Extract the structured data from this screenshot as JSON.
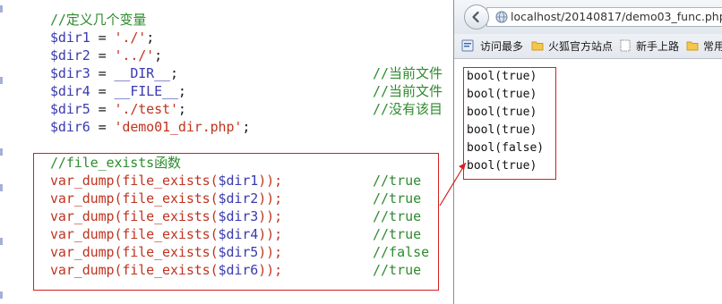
{
  "editor": {
    "lines": [
      {
        "id": "comment_define",
        "comment": "//定义几个变量"
      },
      {
        "var": "$dir1",
        "op": " = ",
        "value": "'./'",
        "end": ";"
      },
      {
        "var": "$dir2",
        "op": " = ",
        "value": "'../'",
        "end": ";"
      },
      {
        "var": "$dir3",
        "op": " = ",
        "const": "__DIR__",
        "end": ";",
        "trail": "//当前文件"
      },
      {
        "var": "$dir4",
        "op": " = ",
        "const": "__FILE__",
        "end": ";",
        "trail": "//当前文件"
      },
      {
        "var": "$dir5",
        "op": " = ",
        "value": "'./test'",
        "end": ";",
        "trail": "//没有该目"
      },
      {
        "var": "$dir6",
        "op": " = ",
        "value": "'demo01_dir.php'",
        "end": ";"
      }
    ],
    "block_comment": "//file_exists函数",
    "calls": [
      {
        "func": "var_dump(file_exists(",
        "arg": "$dir1",
        "close": "));",
        "result": "//true"
      },
      {
        "func": "var_dump(file_exists(",
        "arg": "$dir2",
        "close": "));",
        "result": "//true"
      },
      {
        "func": "var_dump(file_exists(",
        "arg": "$dir3",
        "close": "));",
        "result": "//true"
      },
      {
        "func": "var_dump(file_exists(",
        "arg": "$dir4",
        "close": "));",
        "result": "//true"
      },
      {
        "func": "var_dump(file_exists(",
        "arg": "$dir5",
        "close": "));",
        "result": "//false"
      },
      {
        "func": "var_dump(file_exists(",
        "arg": "$dir6",
        "close": "));",
        "result": "//true"
      }
    ]
  },
  "browser": {
    "url": "localhost/20140817/demo03_func.php",
    "bookmarks": [
      {
        "label": "访问最多",
        "icon": "bookmark-page-icon"
      },
      {
        "label": "火狐官方站点",
        "icon": "folder-icon"
      },
      {
        "label": "新手上路",
        "icon": "page-icon"
      },
      {
        "label": "常用",
        "icon": "folder-icon"
      }
    ],
    "output": [
      "bool(true)",
      "bool(true)",
      "bool(true)",
      "bool(true)",
      "bool(false)",
      "bool(true)"
    ]
  },
  "colors": {
    "comment": "#2e8b2e",
    "variable": "#3a3ab0",
    "string": "#c0341f",
    "highlight_border": "#d42020"
  }
}
